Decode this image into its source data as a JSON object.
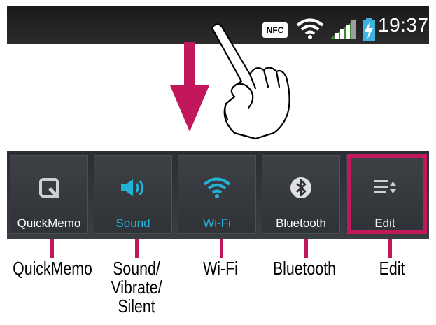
{
  "status_bar": {
    "nfc_label": "NFC",
    "time": "19:37",
    "icons": [
      "nfc-icon",
      "wifi-icon",
      "signal-icon",
      "battery-charging-icon"
    ]
  },
  "gesture": {
    "icons": [
      "down-arrow-icon",
      "swipe-hand-icon"
    ],
    "arrow_color": "#c2185b"
  },
  "quick_settings": {
    "tiles": [
      {
        "label": "QuickMemo",
        "icon": "quickmemo-icon",
        "active": false
      },
      {
        "label": "Sound",
        "icon": "sound-icon",
        "active": true
      },
      {
        "label": "Wi-Fi",
        "icon": "wifi-icon",
        "active": true
      },
      {
        "label": "Bluetooth",
        "icon": "bluetooth-icon",
        "active": false
      },
      {
        "label": "Edit",
        "icon": "edit-icon",
        "active": false
      }
    ],
    "active_color": "#22b3d9",
    "highlight_color": "#c2185b"
  },
  "captions": [
    {
      "text": "QuickMemo"
    },
    {
      "text": "Sound/\nVibrate/\nSilent"
    },
    {
      "text": "Wi-Fi"
    },
    {
      "text": "Bluetooth"
    },
    {
      "text": "Edit"
    }
  ]
}
